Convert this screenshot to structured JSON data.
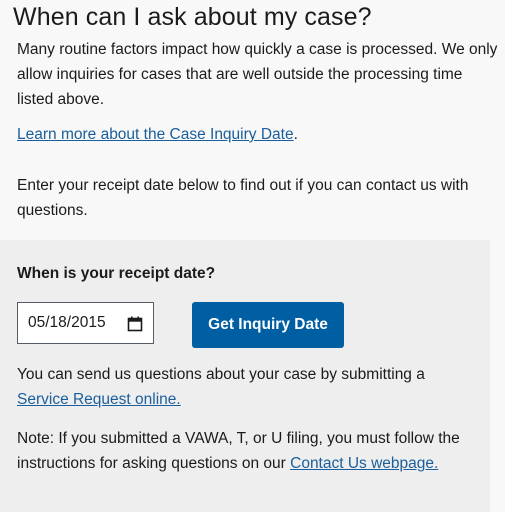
{
  "section": {
    "title": "When can I ask about my case?",
    "intro": "Many routine factors impact how quickly a case is processed. We only allow inquiries for cases that are well outside the processing time listed above.",
    "learn_more_link": "Learn more about the Case Inquiry Date",
    "learn_more_suffix": ".",
    "enter_text": "Enter your receipt date below to find out if you can contact us with questions."
  },
  "panel": {
    "heading": "When is your receipt date?",
    "date_value": "05/18/2015",
    "button_label": "Get Inquiry Date",
    "send_prefix": "You can send us questions about your case by submitting a ",
    "send_link": "Service Request online.",
    "note_prefix": "Note: If you submitted a VAWA, T, or U filing, you must follow the instructions for asking questions on our ",
    "note_link": "Contact Us webpage."
  },
  "icons": {
    "date_picker": "calendar-icon"
  },
  "colors": {
    "link": "#1a5e9b",
    "button": "#005ea2",
    "panel_background": "#eeeeee"
  }
}
